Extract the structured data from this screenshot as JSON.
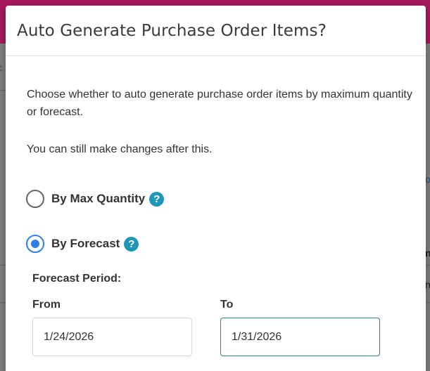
{
  "background": {
    "fragments": [
      "c",
      "o",
      "n",
      "n"
    ]
  },
  "dialog": {
    "title": "Auto Generate Purchase Order Items?",
    "description": "Choose whether to auto generate purchase order items by maximum quantity or forecast.",
    "note": "You can still make changes after this.",
    "options": [
      {
        "label": "By Max Quantity",
        "checked": false,
        "help": "?"
      },
      {
        "label": "By Forecast",
        "checked": true,
        "help": "?"
      }
    ],
    "forecast_period": {
      "label": "Forecast Period:",
      "from_label": "From",
      "from_value": "1/24/2026",
      "to_label": "To",
      "to_value": "1/31/2026"
    }
  },
  "colors": {
    "brand_bar": "#a8195f",
    "radio_selected": "#2f7fe8",
    "help_badge": "#1f97b8",
    "active_field_border": "#2a8a5c"
  },
  "icons": [
    "help-icon",
    "calendar-icon"
  ]
}
